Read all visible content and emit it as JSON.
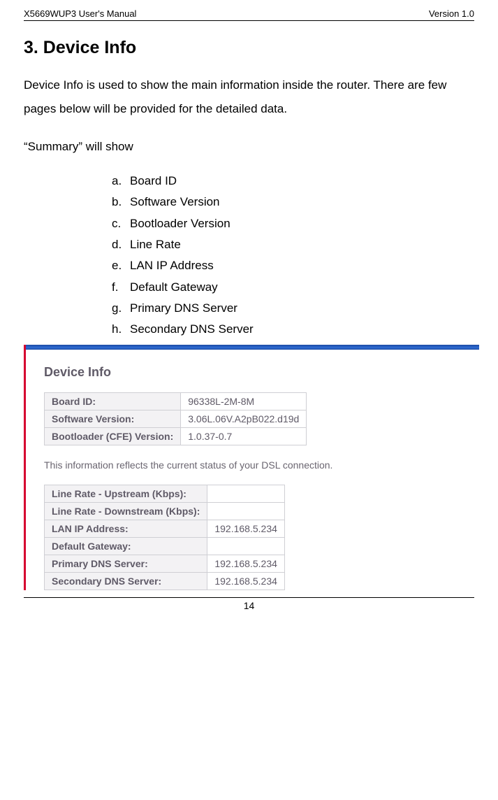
{
  "header": {
    "left": "X5669WUP3 User's Manual",
    "right": "Version 1.0"
  },
  "section": {
    "title": "3.  Device Info",
    "intro": "Device Info is used to show the main information inside the router. There are few pages below will be provided for the detailed data.",
    "list_intro": "“Summary” will show",
    "items": [
      {
        "marker": "a.",
        "text": "Board ID"
      },
      {
        "marker": "b.",
        "text": "Software Version"
      },
      {
        "marker": "c.",
        "text": "Bootloader Version"
      },
      {
        "marker": "d.",
        "text": "Line Rate"
      },
      {
        "marker": "e.",
        "text": "LAN IP Address"
      },
      {
        "marker": "f.",
        "text": "Default Gateway"
      },
      {
        "marker": "g.",
        "text": "Primary DNS Server"
      },
      {
        "marker": "h.",
        "text": "Secondary DNS Server"
      }
    ]
  },
  "screenshot": {
    "heading": "Device Info",
    "table1": [
      {
        "label": "Board ID:",
        "value": "96338L-2M-8M"
      },
      {
        "label": "Software Version:",
        "value": "3.06L.06V.A2pB022.d19d"
      },
      {
        "label": "Bootloader (CFE) Version:",
        "value": "1.0.37-0.7"
      }
    ],
    "note": "This information reflects the current status of your DSL connection.",
    "table2": [
      {
        "label": "Line Rate - Upstream (Kbps):",
        "value": ""
      },
      {
        "label": "Line Rate - Downstream (Kbps):",
        "value": ""
      },
      {
        "label": "LAN IP Address:",
        "value": "192.168.5.234"
      },
      {
        "label": "Default Gateway:",
        "value": ""
      },
      {
        "label": "Primary DNS Server:",
        "value": "192.168.5.234"
      },
      {
        "label": "Secondary DNS Server:",
        "value": "192.168.5.234"
      }
    ]
  },
  "footer": {
    "page": "14"
  }
}
